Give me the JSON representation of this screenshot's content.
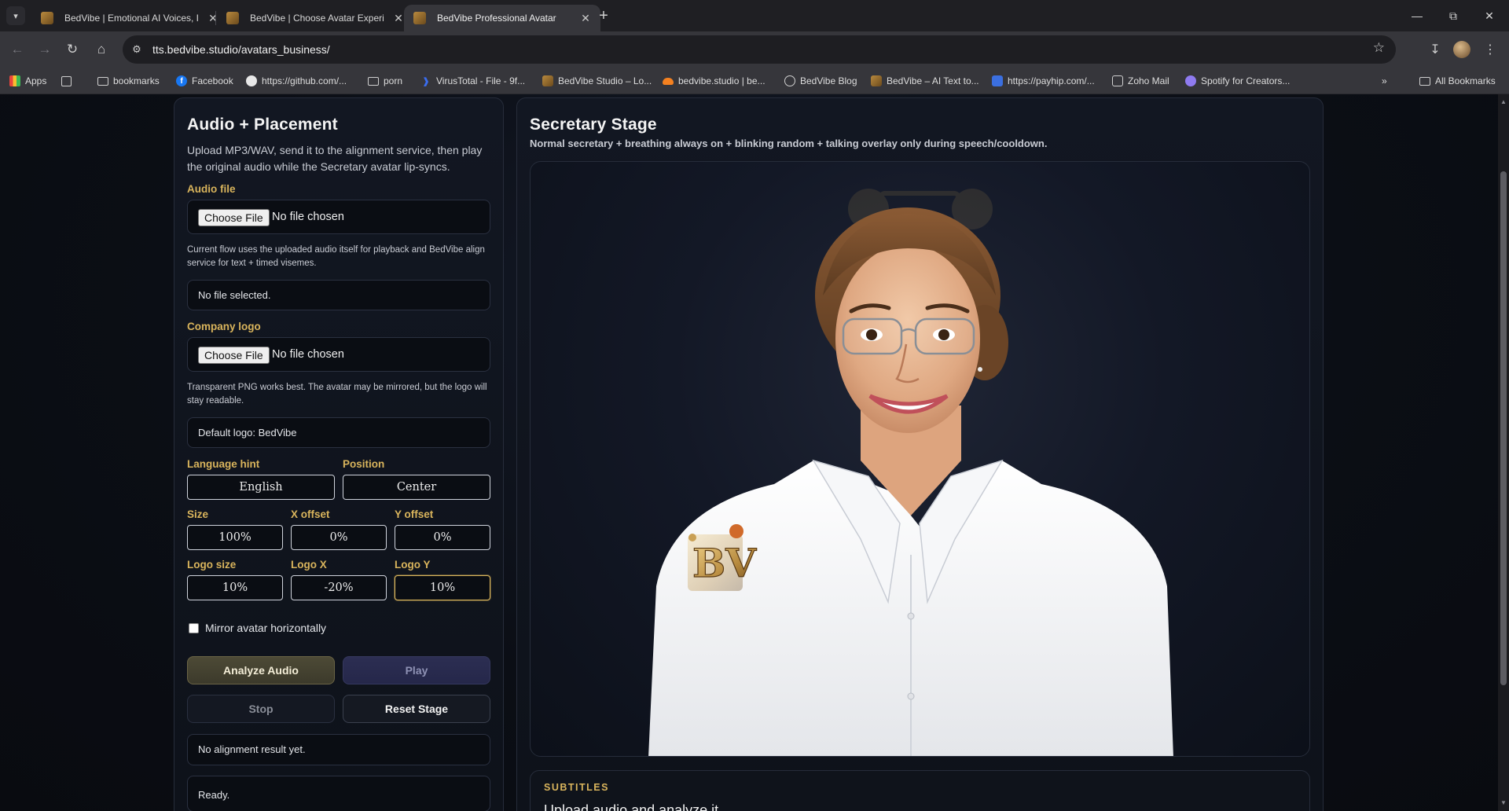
{
  "browser": {
    "tabs": [
      {
        "title": "BedVibe | Emotional AI Voices, I"
      },
      {
        "title": "BedVibe | Choose Avatar Experi"
      },
      {
        "title": "BedVibe Professional Avatar"
      }
    ],
    "url": "tts.bedvibe.studio/avatars_business/",
    "bookmarks": [
      {
        "label": "Apps",
        "icon": "apps-grid-icon"
      },
      {
        "label": "bookmarks",
        "icon": "folder-icon"
      },
      {
        "label": "Facebook",
        "icon": "facebook-icon"
      },
      {
        "label": "https://github.com/...",
        "icon": "github-icon"
      },
      {
        "label": "porn",
        "icon": "folder-icon"
      },
      {
        "label": "VirusTotal - File - 9f...",
        "icon": "virustotal-icon"
      },
      {
        "label": "BedVibe Studio – Lo...",
        "icon": "bedvibe-icon"
      },
      {
        "label": "bedvibe.studio | be...",
        "icon": "cloudflare-icon"
      },
      {
        "label": "BedVibe Blog",
        "icon": "globe-icon"
      },
      {
        "label": "BedVibe – AI Text to...",
        "icon": "bedvibe-icon"
      },
      {
        "label": "https://payhip.com/...",
        "icon": "payhip-icon"
      },
      {
        "label": "Zoho Mail",
        "icon": "zoho-icon"
      },
      {
        "label": "Spotify for Creators...",
        "icon": "spotify-icon"
      }
    ],
    "all_bookmarks": "All Bookmarks"
  },
  "left": {
    "title": "Audio + Placement",
    "description": "Upload MP3/WAV, send it to the alignment service, then play the original audio while the Secretary avatar lip-syncs.",
    "audio_label": "Audio file",
    "choose_file": "Choose File",
    "no_file_chosen": "No file chosen",
    "audio_help": "Current flow uses the uploaded audio itself for playback and BedVibe align service for text + timed visemes.",
    "audio_status": "No file selected.",
    "logo_label": "Company logo",
    "logo_help": "Transparent PNG works best. The avatar may be mirrored, but the logo will stay readable.",
    "logo_status": "Default logo: BedVibe",
    "language_label": "Language hint",
    "language_value": "English",
    "position_label": "Position",
    "position_value": "Center",
    "size_label": "Size",
    "size_value": "100%",
    "xoffset_label": "X offset",
    "xoffset_value": "0%",
    "yoffset_label": "Y offset",
    "yoffset_value": "0%",
    "logosize_label": "Logo size",
    "logosize_value": "10%",
    "logox_label": "Logo X",
    "logox_value": "-20%",
    "logoy_label": "Logo Y",
    "logoy_value": "10%",
    "mirror_label": "Mirror avatar horizontally",
    "analyze": "Analyze Audio",
    "play": "Play",
    "stop": "Stop",
    "reset": "Reset Stage",
    "alignment_status": "No alignment result yet.",
    "ready_status": "Ready."
  },
  "right": {
    "title": "Secretary Stage",
    "subtitle": "Normal secretary + breathing always on + blinking random + talking overlay only during speech/cooldown.",
    "logo_text": "BV",
    "subtitles_label": "SUBTITLES",
    "subtitles_text": "Upload audio and analyze it."
  },
  "colors": {
    "accent_gold": "#d9b45c",
    "panel_bg": "#121722",
    "page_bg": "#0b0e14"
  }
}
